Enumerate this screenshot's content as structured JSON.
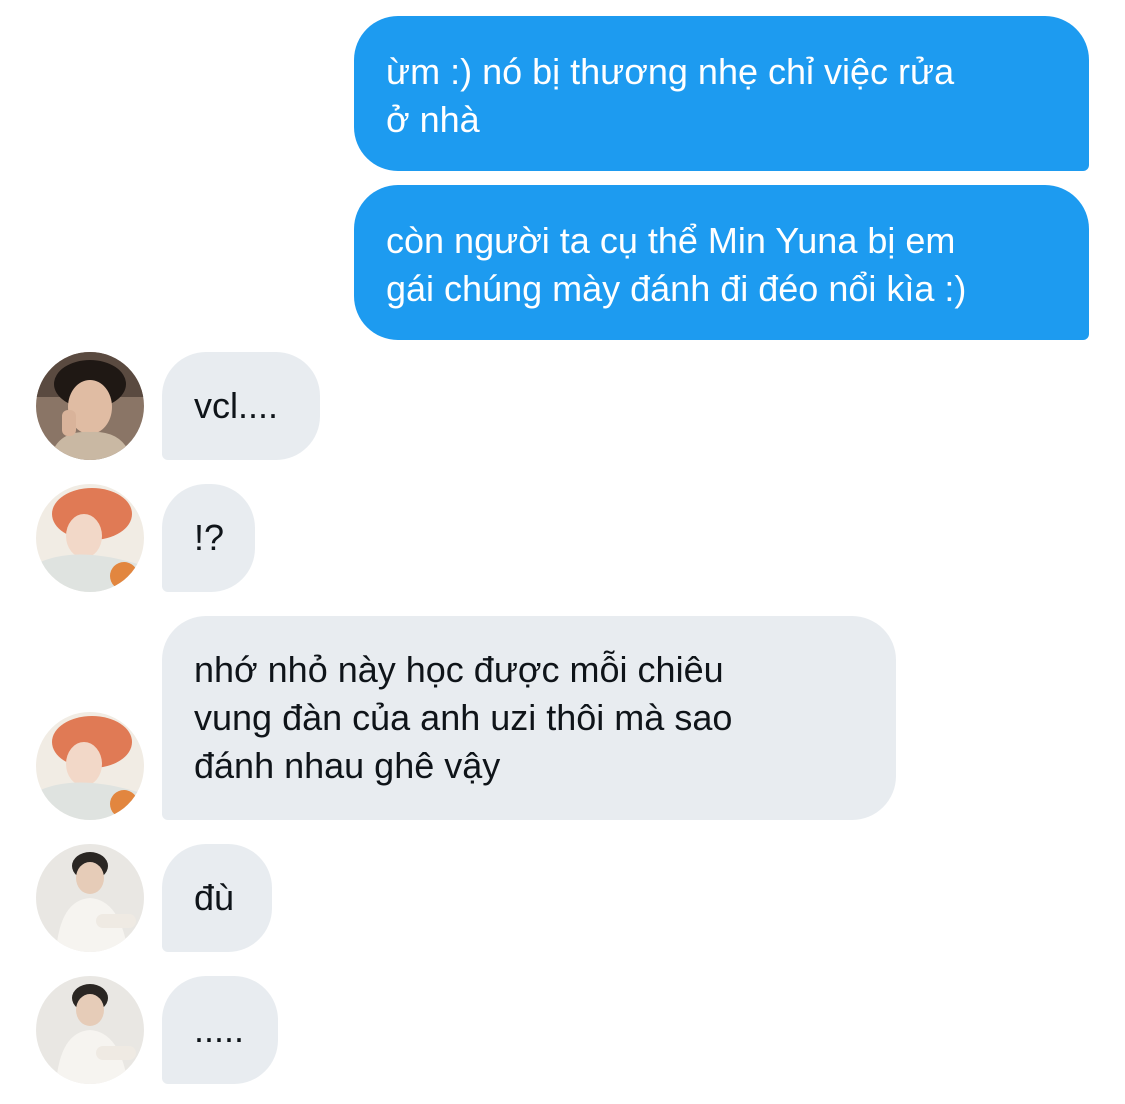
{
  "messages": [
    {
      "direction": "sent",
      "text": "ừm :) nó bị thương nhẹ chỉ việc rửa\nở nhà"
    },
    {
      "direction": "sent",
      "text": "còn người ta cụ thể Min Yuna bị em\ngái chúng mày đánh đi đéo nổi kìa :)"
    },
    {
      "direction": "received",
      "avatar": "dark-hair-hoodie-avatar",
      "text": "vcl...."
    },
    {
      "direction": "received",
      "avatar": "orange-hair-avatar",
      "text": "!?"
    },
    {
      "direction": "received",
      "avatar": "orange-hair-avatar",
      "text": "nhớ nhỏ này học được mỗi chiêu\nvung đàn của anh uzi thôi mà sao\nđánh nhau ghê vậy"
    },
    {
      "direction": "received",
      "avatar": "white-outfit-avatar",
      "text": "đù"
    },
    {
      "direction": "received",
      "avatar": "white-outfit-avatar",
      "text": "....."
    }
  ],
  "colors": {
    "sent_bubble": "#1d9bf0",
    "received_bubble": "#e8ecf0",
    "sent_text": "#ffffff",
    "received_text": "#0f1419"
  }
}
